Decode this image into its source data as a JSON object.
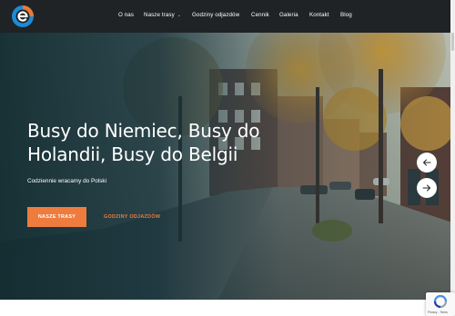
{
  "nav": {
    "items": [
      {
        "label": "O nas"
      },
      {
        "label": "Nasze trasy",
        "dropdown": true
      },
      {
        "label": "Godziny odjazdów"
      },
      {
        "label": "Cennik"
      },
      {
        "label": "Galeria"
      },
      {
        "label": "Kontakt"
      },
      {
        "label": "Blog"
      }
    ]
  },
  "hero": {
    "title_line1": "Busy do Niemiec, Busy do",
    "title_line2": "Holandii, Busy do Belgii",
    "subtitle": "Codziennie wracamy do Polski",
    "primary_button": "NASZE TRASY",
    "secondary_link": "GODZINY ODJAZDÓW"
  },
  "recaptcha": {
    "footer_text": "Privacy - Terms"
  },
  "colors": {
    "accent": "#ee7c3f",
    "header_bg": "#1f2326",
    "logo_blue": "#1f8ad6",
    "logo_orange": "#ef7a2e"
  },
  "icons": {
    "logo": "brand-logo-icon",
    "dropdown": "chevron-down-icon",
    "prev": "arrow-left-icon",
    "next": "arrow-right-icon"
  }
}
